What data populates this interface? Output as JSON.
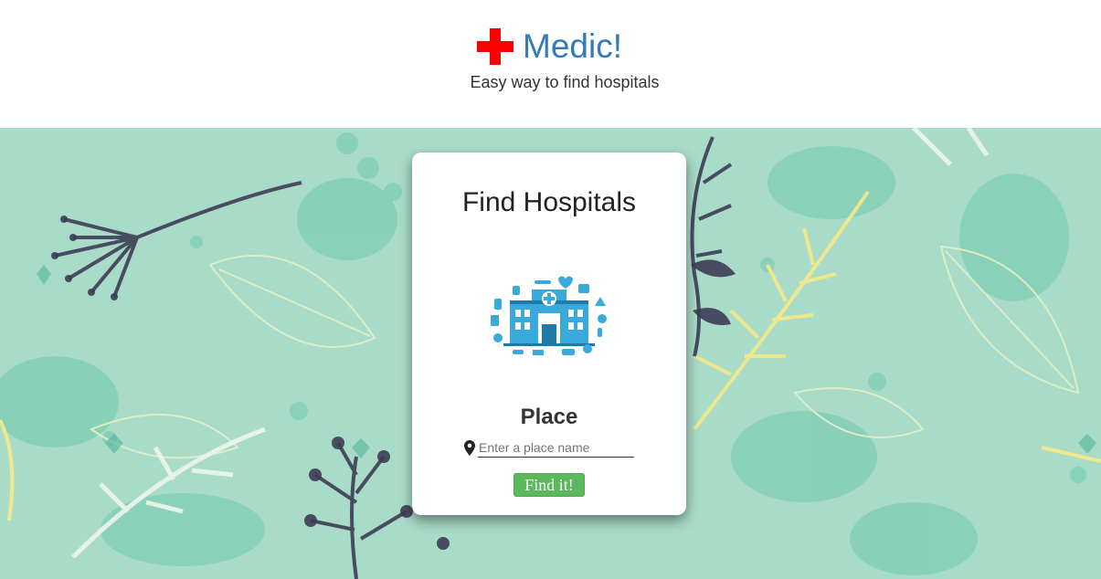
{
  "header": {
    "brand_title": "Medic!",
    "brand_icon": "red-cross-icon",
    "tagline": "Easy way to find hospitals"
  },
  "search_card": {
    "title": "Find Hospitals",
    "illustration": "hospital-illustration",
    "place_label": "Place",
    "place_input": {
      "value": "",
      "placeholder": "Enter a place name",
      "icon": "map-pin-icon"
    },
    "submit_label": "Find it!"
  },
  "colors": {
    "brand_title": "#337ab7",
    "brand_icon": "#ff0000",
    "banner_background": "#a9dcc8",
    "button": "#5cb85c"
  }
}
